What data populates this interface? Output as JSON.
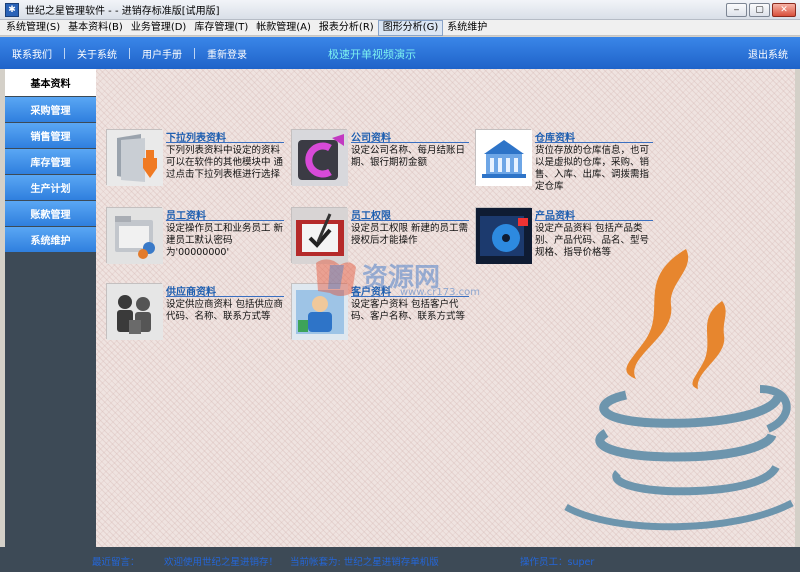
{
  "window": {
    "title": "世纪之星管理软件 - - 进销存标准版[试用版]",
    "controls": {
      "minimize": "‒",
      "maximize": "▢",
      "close": "✕"
    }
  },
  "menubar": {
    "items": [
      {
        "label": "系统管理(S)"
      },
      {
        "label": "基本资料(B)"
      },
      {
        "label": "业务管理(D)"
      },
      {
        "label": "库存管理(T)"
      },
      {
        "label": "帐款管理(A)"
      },
      {
        "label": "报表分析(R)"
      },
      {
        "label": "图形分析(G)"
      },
      {
        "label": "系统维护"
      }
    ],
    "active_index": 6
  },
  "topnav": {
    "links": [
      {
        "label": "联系我们"
      },
      {
        "label": "关于系统"
      },
      {
        "label": "用户手册"
      },
      {
        "label": "重新登录"
      }
    ],
    "promo": "极速开单视频演示",
    "logout": "退出系统"
  },
  "sidebar": {
    "items": [
      {
        "label": "基本资料",
        "active": true
      },
      {
        "label": "采购管理"
      },
      {
        "label": "销售管理"
      },
      {
        "label": "库存管理"
      },
      {
        "label": "生产计划"
      },
      {
        "label": "账款管理"
      },
      {
        "label": "系统维护"
      }
    ]
  },
  "modules": [
    {
      "title": "下拉列表资料",
      "desc": "下列列表资料中设定的资料可以在软件的其他模块中 通过点击下拉列表框进行选择",
      "icon": "folder-arrow-icon"
    },
    {
      "title": "公司资料",
      "desc": "设定公司名称、每月结账日期、银行期初金额",
      "icon": "company-logo-icon"
    },
    {
      "title": "仓库资料",
      "desc": "货位存放的仓库信息，也可以是虚拟的仓库，采购、销售、入库、出库、调拨需指定仓库",
      "icon": "warehouse-icon"
    },
    {
      "title": "员工资料",
      "desc": "设定操作员工和业务员工 新建员工默认密码为'00000000'",
      "icon": "staff-folder-icon"
    },
    {
      "title": "员工权限",
      "desc": "设定员工权限 新建的员工需授权后才能操作",
      "icon": "permission-check-icon"
    },
    {
      "title": "产品资料",
      "desc": "设定产品资料 包括产品类别、产品代码、品名、型号规格、指导价格等",
      "icon": "product-disc-icon"
    },
    {
      "title": "供应商资料",
      "desc": "设定供应商资料 包括供应商代码、名称、联系方式等",
      "icon": "supplier-people-icon"
    },
    {
      "title": "客户资料",
      "desc": "设定客户资料 包括客户代码、客户名称、联系方式等",
      "icon": "customer-person-icon"
    }
  ],
  "watermark": {
    "text": "资源网",
    "sub": "www.cr173.com"
  },
  "status": {
    "items": [
      {
        "label": "最近留言："
      },
      {
        "label": "欢迎使用世纪之星进销存！"
      },
      {
        "label": "当前帐套为: 世纪之星进销存单机版"
      },
      {
        "label": "操作员工：super"
      }
    ]
  },
  "colors": {
    "nav_blue": "#1f63c9",
    "sidebar_blue": "#2f7fde",
    "sidebar_dark": "#3d4a56",
    "link_blue": "#1f5fb0",
    "java_orange": "#e7862e",
    "java_steel": "#6d95ad"
  }
}
